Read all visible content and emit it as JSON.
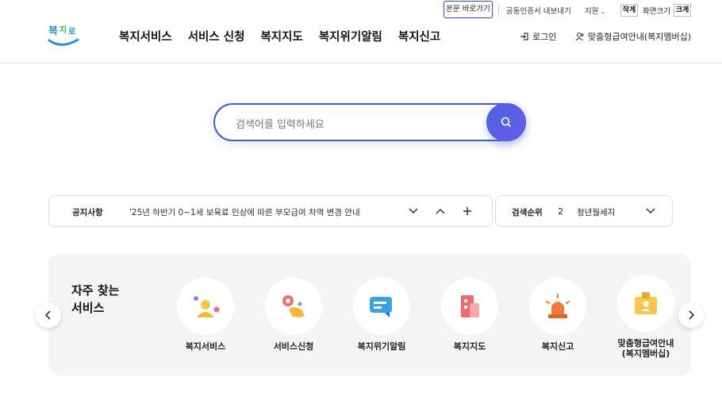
{
  "util": {
    "skip_link": "본문 바로가기",
    "cert_export": "공동인증서 내보내기",
    "support": "지원",
    "font_small": "작게",
    "font_size_label": "화면크기",
    "font_large": "크게"
  },
  "header": {
    "logo_text": "복지로",
    "nav": [
      "복지서비스",
      "서비스 신청",
      "복지지도",
      "복지위기알림",
      "복지신고"
    ],
    "login": "로그인",
    "membership": "맞춤형급여안내(복지멤버십)"
  },
  "search": {
    "placeholder": "검색어를 입력하세요"
  },
  "notice": {
    "label": "공지사항",
    "text": "'25년 하반기 0~1세 보육료 인상에 따른 부모급여 차액 변경 안내"
  },
  "rank": {
    "label": "검색순위",
    "number": "2",
    "term": "청년월세지원"
  },
  "services": {
    "title_line1": "자주 찾는",
    "title_line2": "서비스",
    "items": [
      {
        "label": "복지서비스",
        "icon": "welfare-service-icon"
      },
      {
        "label": "서비스신청",
        "icon": "service-apply-icon"
      },
      {
        "label": "복지위기알림",
        "icon": "crisis-alert-icon"
      },
      {
        "label": "복지지도",
        "icon": "welfare-map-icon"
      },
      {
        "label": "복지신고",
        "icon": "welfare-report-icon"
      },
      {
        "label": "맞춤형급여안내",
        "label2": "(복지멤버십)",
        "icon": "membership-icon"
      }
    ]
  },
  "colors": {
    "accent": "#3d5bd6",
    "panel_bg": "#f4f4f4"
  }
}
